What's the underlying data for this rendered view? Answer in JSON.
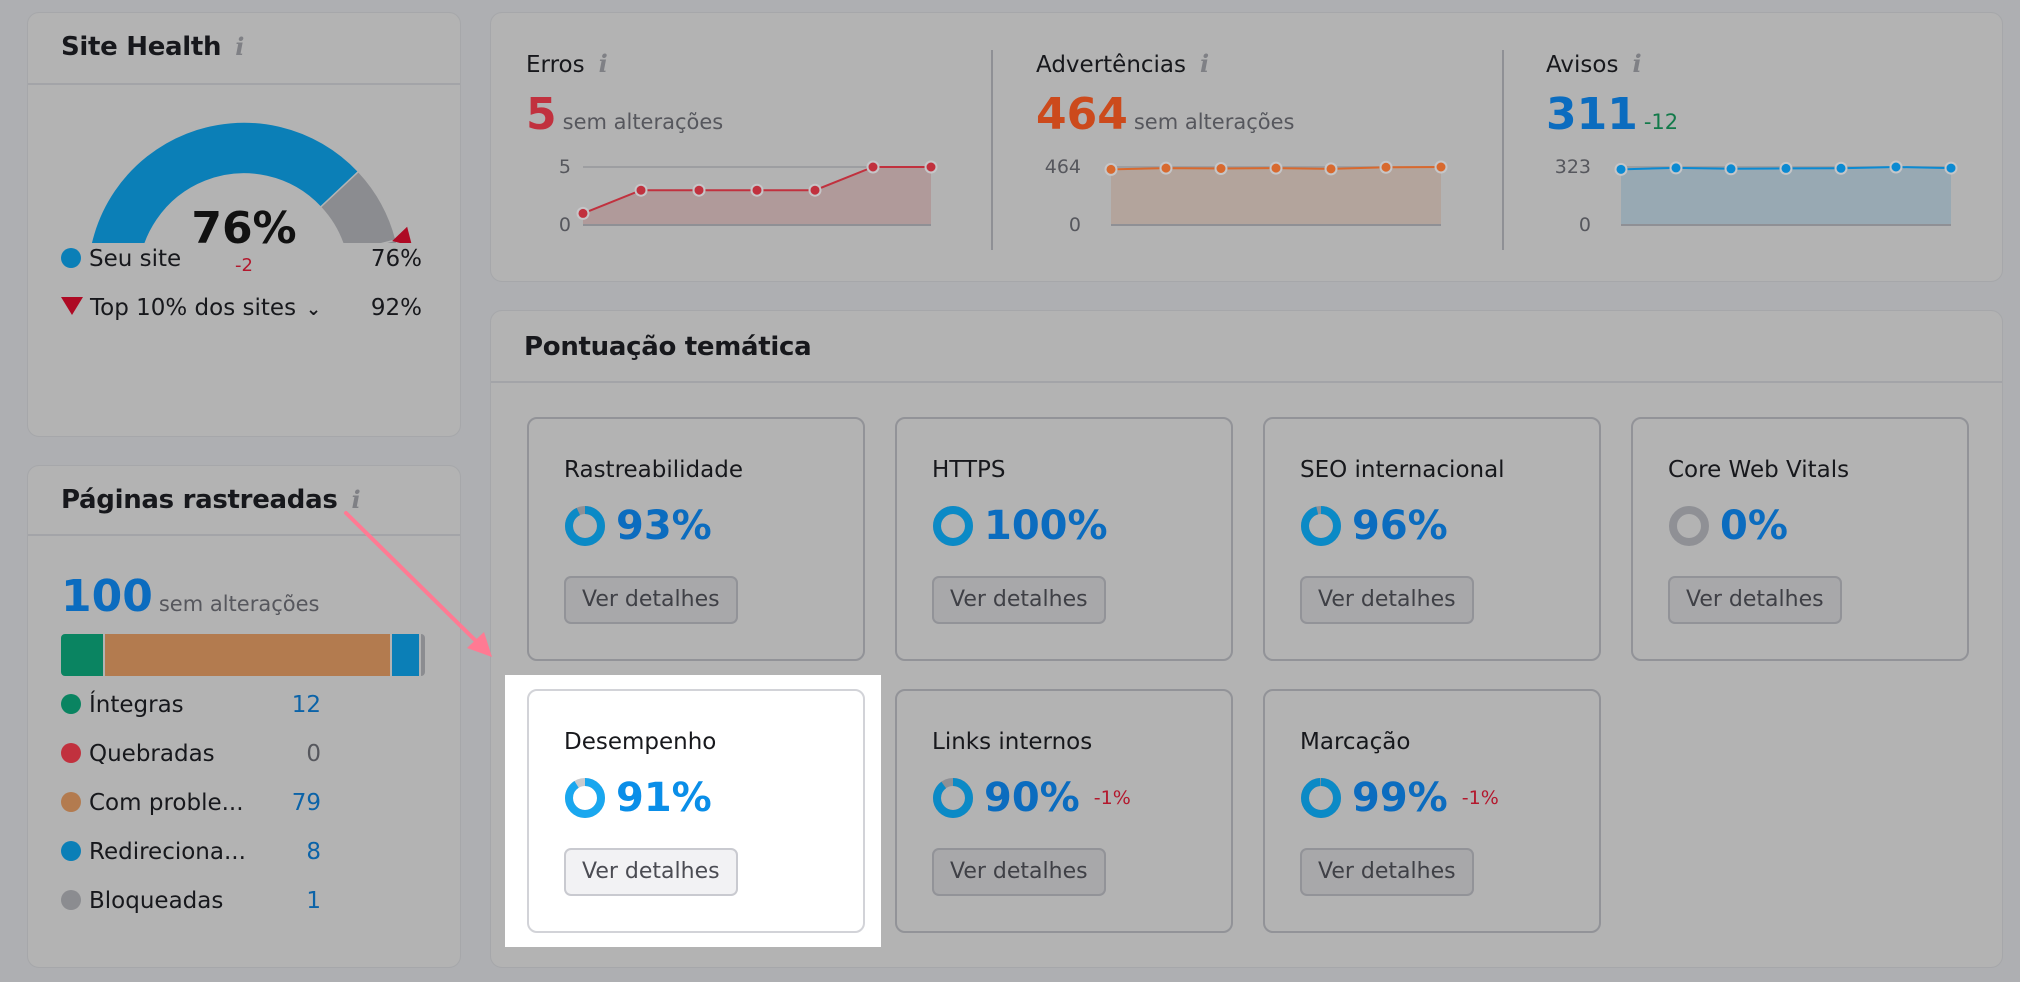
{
  "site_health": {
    "title": "Site Health",
    "info_icon": "info-icon",
    "score": "76%",
    "score_value": 76,
    "delta": "-2",
    "top10_value": 92,
    "legend": [
      {
        "label": "Seu site",
        "value": "76%",
        "marker": "dot",
        "color": "#0b7fb7"
      },
      {
        "label": "Top 10% dos sites",
        "value": "92%",
        "marker": "triangle-down",
        "color": "#ae0a24",
        "has_dropdown": true
      }
    ],
    "colors": {
      "filled": "#0b7fb7",
      "remaining": "#8b8c90",
      "marker": "#ae0a24"
    }
  },
  "crawled_pages": {
    "title": "Páginas rastreadas",
    "total": "100",
    "total_sub": "sem alterações",
    "categories": [
      {
        "label": "Íntegras",
        "count": 12,
        "color": "#0a8461"
      },
      {
        "label": "Quebradas",
        "count": 0,
        "color": "#c1313e"
      },
      {
        "label": "Com proble...",
        "count": 79,
        "color": "#b37b4f"
      },
      {
        "label": "Redireciona...",
        "count": 8,
        "color": "#0b7fb7"
      },
      {
        "label": "Bloqueadas",
        "count": 1,
        "color": "#8b8c90"
      }
    ]
  },
  "stats": [
    {
      "label": "Erros",
      "value": "5",
      "value_color": "#c1313e",
      "sub": "sem alterações",
      "sub_type": "neutral",
      "line_color": "#c1313e",
      "fill_color": "#b09a9a",
      "y_ticks": [
        "5",
        "0"
      ],
      "y_max": 5,
      "points": [
        1,
        3,
        3,
        3,
        3,
        5,
        5
      ]
    },
    {
      "label": "Advertências",
      "value": "464",
      "value_color": "#cc4a1c",
      "sub": "sem alterações",
      "sub_type": "neutral",
      "line_color": "#d8692e",
      "fill_color": "#b3a49c",
      "y_ticks": [
        "464",
        "0"
      ],
      "y_max": 464,
      "points": [
        445,
        455,
        452,
        455,
        449,
        462,
        464
      ]
    },
    {
      "label": "Avisos",
      "value": "311",
      "value_color": "#0b6cbf",
      "sub": "-12",
      "sub_type": "good",
      "line_color": "#0b8ad2",
      "fill_color": "#98a9b3",
      "y_ticks": [
        "323",
        "0"
      ],
      "y_max": 323,
      "points": [
        310,
        318,
        313,
        315,
        316,
        323,
        317
      ]
    }
  ],
  "thematic": {
    "title": "Pontuação temática",
    "button_label": "Ver detalhes",
    "tiles": [
      {
        "name": "Rastreabilidade",
        "score": "93%",
        "value": 93,
        "delta": ""
      },
      {
        "name": "HTTPS",
        "score": "100%",
        "value": 100,
        "delta": ""
      },
      {
        "name": "SEO internacional",
        "score": "96%",
        "value": 96,
        "delta": ""
      },
      {
        "name": "Core Web Vitals",
        "score": "0%",
        "value": 0,
        "delta": ""
      },
      {
        "name": "Desempenho",
        "score": "91%",
        "value": 91,
        "delta": "",
        "highlighted": true
      },
      {
        "name": "Links internos",
        "score": "90%",
        "value": 90,
        "delta": "-1%"
      },
      {
        "name": "Marcação",
        "score": "99%",
        "value": 99,
        "delta": "-1%"
      }
    ]
  },
  "annotation": {
    "type": "arrow",
    "color": "#ff7a93",
    "from": "crawled_pages.info_icon",
    "to": "thematic.tiles.4"
  }
}
